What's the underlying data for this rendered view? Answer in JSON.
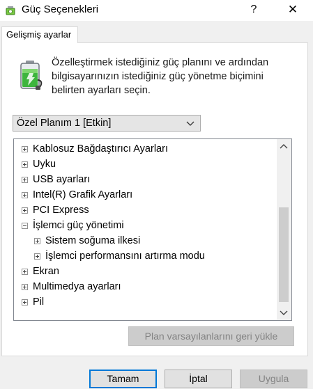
{
  "window": {
    "title": "Güç Seçenekleri",
    "help": "?",
    "close": "✕"
  },
  "tab": {
    "label": "Gelişmiş ayarlar"
  },
  "description": "Özelleştirmek istediğiniz güç planını ve ardından bilgisayarınızın istediğiniz güç yönetme biçimini belirten ayarları seçin.",
  "plan_select": {
    "value": "Özel Planım 1 [Etkin]"
  },
  "tree": {
    "items": [
      {
        "label": "Kablosuz Bağdaştırıcı Ayarları",
        "expander": "plus"
      },
      {
        "label": "Uyku",
        "expander": "plus"
      },
      {
        "label": "USB ayarları",
        "expander": "plus"
      },
      {
        "label": "Intel(R) Grafik Ayarları",
        "expander": "plus"
      },
      {
        "label": "PCI Express",
        "expander": "plus"
      },
      {
        "label": "İşlemci güç yönetimi",
        "expander": "minus"
      },
      {
        "label": "Sistem soğuma ilkesi",
        "expander": "plus"
      },
      {
        "label": "İşlemci performansını artırma modu",
        "expander": "plus"
      },
      {
        "label": "Ekran",
        "expander": "plus"
      },
      {
        "label": "Multimedya ayarları",
        "expander": "plus"
      },
      {
        "label": "Pil",
        "expander": "plus"
      }
    ]
  },
  "restore_button": "Plan varsayılanlarını geri yükle",
  "buttons": {
    "ok": "Tamam",
    "cancel": "İptal",
    "apply": "Uygula"
  },
  "colors": {
    "accent": "#0078d7",
    "battery_green": "#3db53d"
  },
  "icons": {
    "app": "power-options-icon",
    "battery": "battery-plug-icon",
    "chevron": "chevron-down-icon"
  }
}
